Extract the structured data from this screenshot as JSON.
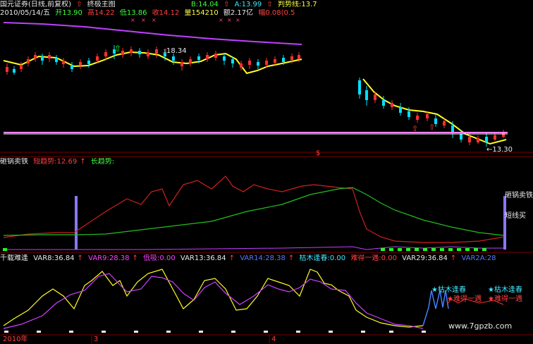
{
  "header": {
    "title": "国元证券(日线,前复权)",
    "indicator": "终极主图",
    "b_label": "B:14.04",
    "a_label": "A:13.99",
    "trend_label": "判势线:13.7"
  },
  "quote": {
    "date": "2010/05/14/五",
    "open": "开13.90",
    "high": "高14.22",
    "low": "低13.86",
    "close": "收14.12",
    "volume": "量154210",
    "amount": "额2.17亿",
    "change": "幅0.08(0.5"
  },
  "main_chart": {
    "peak_label": "18.34",
    "low_label": "←13.30",
    "low_marker": "$"
  },
  "panel2": {
    "name": "砸锅卖铁",
    "short_label": "短趋势:12.69",
    "long_label": "长趋势:",
    "right_label_1": "砸锅卖铁",
    "right_label_2": "短线买"
  },
  "panel3": {
    "name": "千载难逢",
    "var8": "VAR8:36.84",
    "var9": "VAR9:28.38",
    "low_suck": "低吸:0.00",
    "var13": "VAR13:36.84",
    "var14": "VAR14:28.38",
    "spring": "枯木逢春:0.00",
    "rare": "难得一遇:0.00",
    "var29": "VAR29:36.84",
    "var2a": "VAR2A:28",
    "sig1": "★枯木逢春",
    "sig2": "★枯木逢春",
    "sig3": "★难得一遇",
    "sig4": "★难得一遇"
  },
  "axis": {
    "year": "2010年",
    "m3": "3",
    "m4": "4"
  },
  "watermark": "www.7gpzb.com",
  "colors": {
    "background": "#000000",
    "up": "#ff3030",
    "down": "#00ffff",
    "trend": "#ffff00",
    "long": "#ff40ff",
    "short_trend": "#e02020",
    "long_trend": "#20c020"
  }
}
